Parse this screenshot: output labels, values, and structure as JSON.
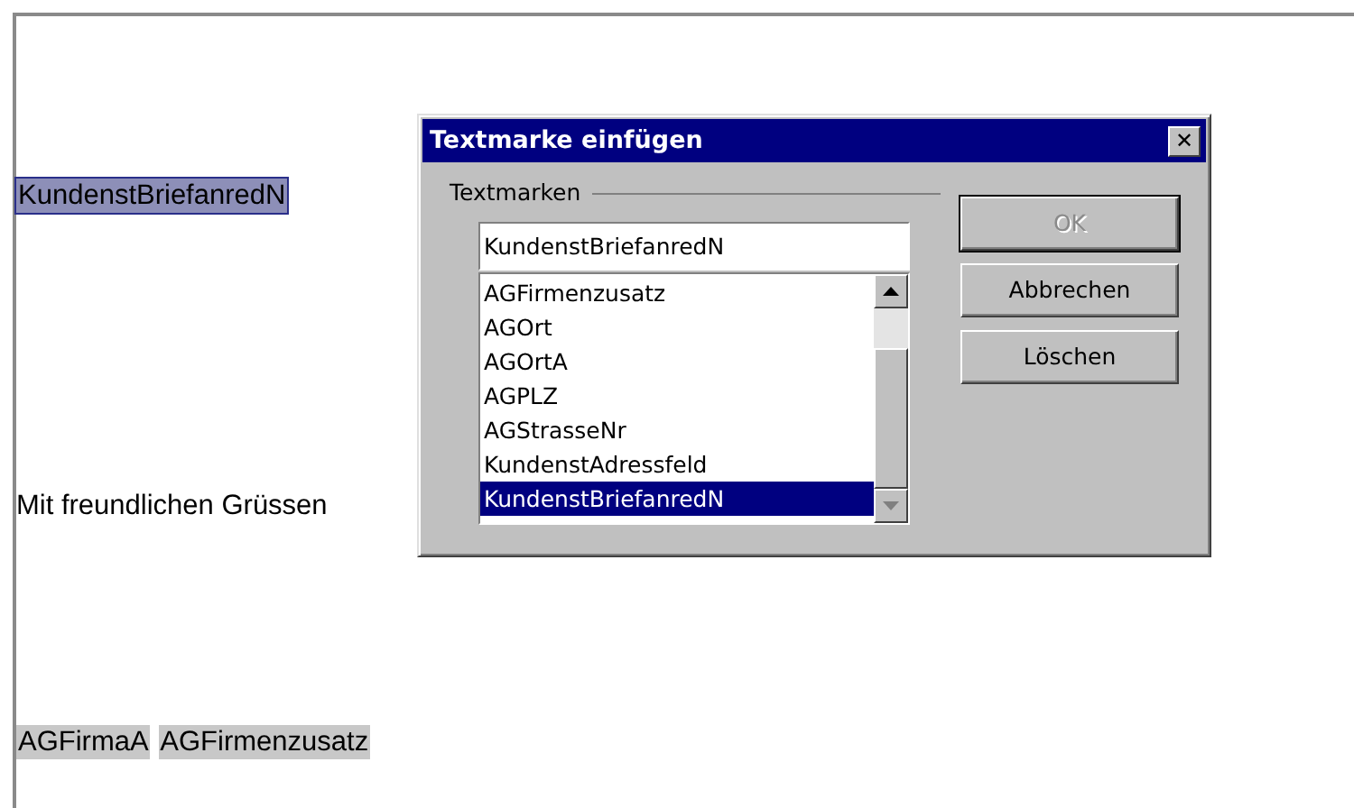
{
  "document": {
    "fields": [
      {
        "text": "KundenstBriefanredN",
        "selected": true
      }
    ],
    "closing": "Mit freundlichen Grüssen",
    "signature_fields": [
      {
        "text": "AGFirmaA",
        "selected": false
      },
      {
        "text": "AGFirmenzusatz",
        "selected": false
      }
    ]
  },
  "dialog": {
    "title": "Textmarke einfügen",
    "close": "✕",
    "group_label": "Textmarken",
    "input": {
      "value": "KundenstBriefanredN"
    },
    "list": [
      {
        "label": "AGFirmenzusatz",
        "selected": false
      },
      {
        "label": "AGOrt",
        "selected": false
      },
      {
        "label": "AGOrtA",
        "selected": false
      },
      {
        "label": "AGPLZ",
        "selected": false
      },
      {
        "label": "AGStrasseNr",
        "selected": false
      },
      {
        "label": "KundenstAdressfeld",
        "selected": false
      },
      {
        "label": "KundenstBriefanredN",
        "selected": true
      }
    ],
    "buttons": [
      {
        "label": "OK",
        "disabled": true,
        "default": true
      },
      {
        "label": "Abbrechen",
        "disabled": false,
        "default": false
      },
      {
        "label": "Löschen",
        "disabled": false,
        "default": false
      }
    ]
  }
}
